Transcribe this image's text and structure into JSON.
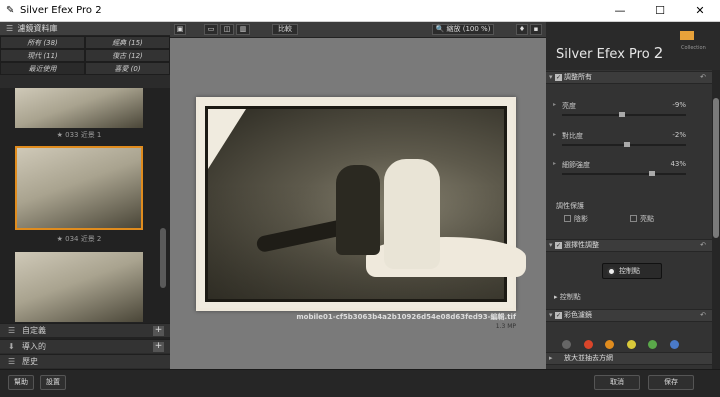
{
  "window": {
    "title": "Silver Efex Pro 2",
    "minimize": "—",
    "maximize": "☐",
    "close": "✕"
  },
  "left_panel": {
    "header": "濾鏡資料庫",
    "tabs": [
      {
        "label": "所有 (38)"
      },
      {
        "label": "經典 (15)"
      },
      {
        "label": "現代 (11)"
      },
      {
        "label": "復古 (12)"
      },
      {
        "label": "最近使用"
      },
      {
        "label": "喜愛 (0)"
      }
    ],
    "thumbnails": [
      {
        "label": "★ 033 近景 1"
      },
      {
        "label": "★ 034 近景 2"
      },
      {
        "label": ""
      }
    ],
    "sections": [
      {
        "label": "自定義",
        "icon": "☰"
      },
      {
        "label": "導入的",
        "icon": "⬇"
      },
      {
        "label": "歷史",
        "icon": "☰"
      }
    ]
  },
  "toolbar": {
    "zoom_label": "縮放 (100 %)",
    "compare_label": "比較"
  },
  "preview": {
    "filename": "mobile01-cf5b3063b4a2b10926d54e08d63fed93-編輯.tif",
    "filesize": "1.3 MP"
  },
  "right_panel": {
    "brand": "Silver Efex Pro",
    "brand_version": "2",
    "badge": "Collection",
    "sections": [
      {
        "label": "調整所有"
      },
      {
        "label": "選擇性調整"
      },
      {
        "label": "彩色濾鏡"
      },
      {
        "label": "放大並抽去方網"
      }
    ],
    "sliders": [
      {
        "label": "亮度",
        "value": "-9%"
      },
      {
        "label": "對比度",
        "value": "-2%"
      },
      {
        "label": "細節強度",
        "value": "43%"
      }
    ],
    "tone_protection": {
      "title": "調性保護",
      "shadows": "陰影",
      "highlights": "亮點"
    },
    "control_point_button": "控制點",
    "control_points_label": "控制點",
    "color_dots": [
      "#666666",
      "#d9452a",
      "#e08c1e",
      "#d9c93a",
      "#5aa84a",
      "#4a7ac8"
    ]
  },
  "bottom": {
    "help": "幫助",
    "settings": "設置",
    "cancel": "取消",
    "save": "保存"
  }
}
